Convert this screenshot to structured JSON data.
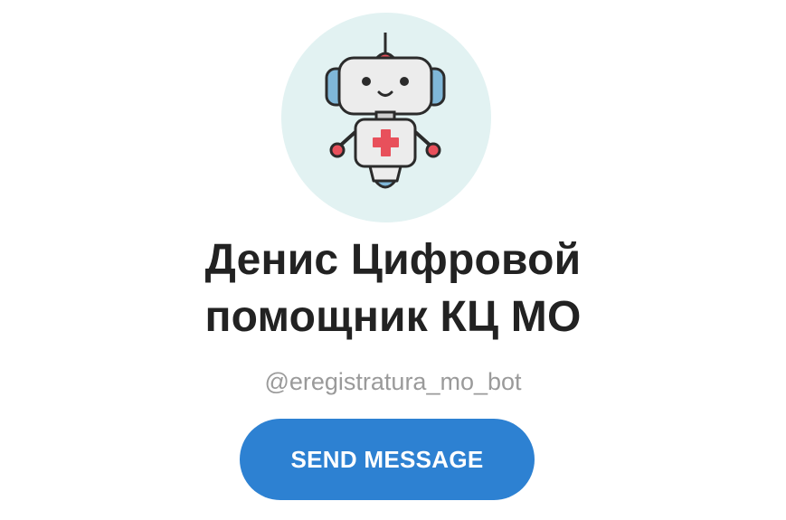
{
  "profile": {
    "avatar_icon": "medical-robot-icon",
    "name_line1": "Денис Цифровой",
    "name_line2": "помощник КЦ МО",
    "username": "@eregistratura_mo_bot",
    "send_button_label": "SEND MESSAGE"
  },
  "colors": {
    "avatar_background": "#e2f2f2",
    "button_background": "#2d81d2",
    "button_text": "#ffffff",
    "name_text": "#222222",
    "username_text": "#9a9a9a",
    "accent_red": "#e8505b",
    "accent_blue": "#7fb7d8"
  }
}
